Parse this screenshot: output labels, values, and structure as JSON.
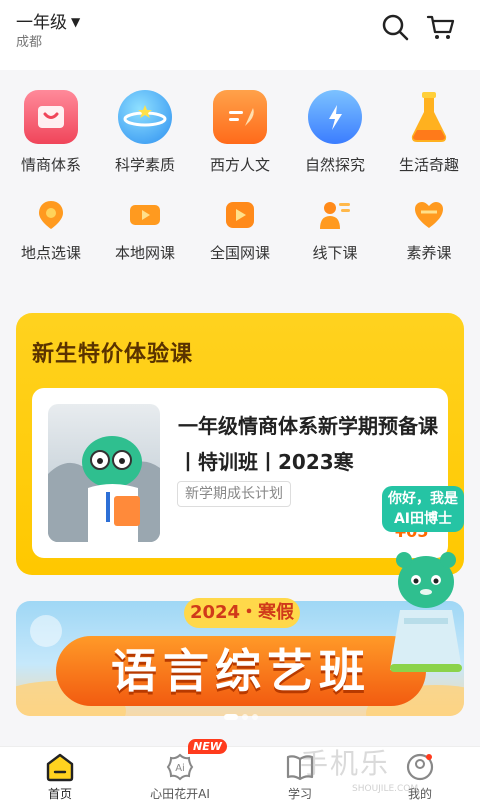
{
  "header": {
    "grade": "一年级",
    "city": "成都",
    "icons": [
      "search-icon",
      "cart-icon"
    ]
  },
  "categories": [
    {
      "label": "情商体系",
      "icon": "eq-icon"
    },
    {
      "label": "科学素质",
      "icon": "planet-icon"
    },
    {
      "label": "西方人文",
      "icon": "quill-icon"
    },
    {
      "label": "自然探究",
      "icon": "cloud-bolt-icon"
    },
    {
      "label": "生活奇趣",
      "icon": "flask-icon"
    }
  ],
  "subnav": [
    {
      "label": "地点选课",
      "icon": "location-icon"
    },
    {
      "label": "本地网课",
      "icon": "play-card-icon"
    },
    {
      "label": "全国网课",
      "icon": "play-icon"
    },
    {
      "label": "线下课",
      "icon": "teacher-icon"
    },
    {
      "label": "素养课",
      "icon": "heart-icon"
    }
  ],
  "promo": {
    "title": "新生特价体验课",
    "course_title": "一年级情商体系新学期预备课丨特训班丨2023寒",
    "tag": "新学期成长计划",
    "price_partial": "¥05",
    "ai_bubble_line1": "你好，我是",
    "ai_bubble_line2": "AI田博士"
  },
  "banner": {
    "subtitle": "2024・寒假",
    "title": "语言综艺班"
  },
  "tabbar": {
    "items": [
      {
        "label": "首页",
        "icon": "home-icon",
        "active": true
      },
      {
        "label": "心田花开AI",
        "icon": "ai-icon",
        "badge": "NEW"
      },
      {
        "label": "学习",
        "icon": "book-icon"
      },
      {
        "label": "我的",
        "icon": "profile-icon"
      }
    ]
  },
  "watermark": {
    "text": "手机乐",
    "sub": "SHOUJILE.COM"
  },
  "colors": {
    "accent": "#ffc800",
    "brand_dark": "#5a3300",
    "ai_green": "#25c4a4",
    "badge_red": "#ff3b1d"
  }
}
